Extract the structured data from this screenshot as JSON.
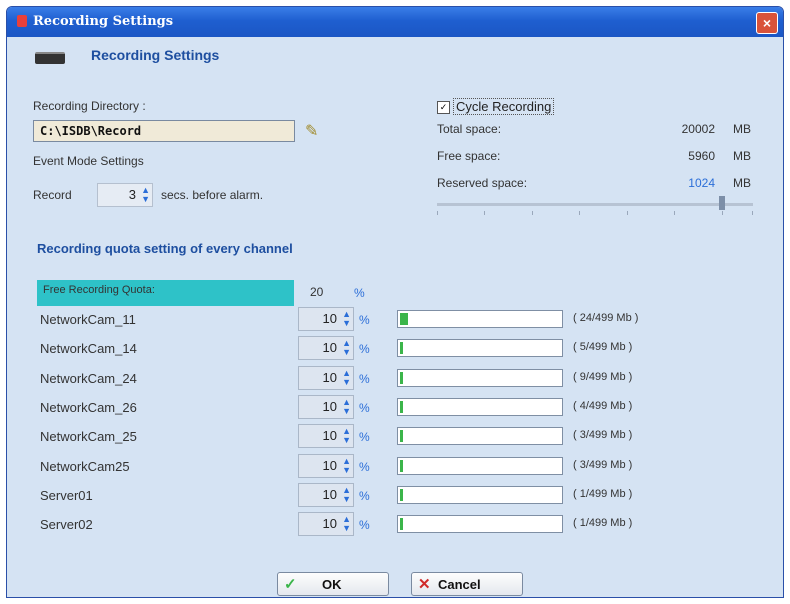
{
  "window": {
    "title": "Recording Settings",
    "close_icon": "×"
  },
  "header": {
    "title": "Recording  Settings",
    "icon": "recorder-icon"
  },
  "directory": {
    "label": "Recording Directory :",
    "value": "C:\\ISDB\\Record",
    "browse_icon": "browse-folder-icon"
  },
  "event_mode": {
    "label": "Event Mode Settings",
    "record_label": "Record",
    "seconds_value": "3",
    "suffix": "secs. before alarm."
  },
  "cycle": {
    "label": "Cycle Recording",
    "checked": true,
    "check_mark": "✓"
  },
  "space": {
    "total_label": "Total space:",
    "total_value": "20002",
    "free_label": "Free space:",
    "free_value": "5960",
    "reserved_label": "Reserved space:",
    "reserved_value": "1024",
    "unit": "MB",
    "reserved_slider_fraction": 0.91
  },
  "quota": {
    "section_title": "Recording quota setting of every channel",
    "free_label": "Free Recording Quota:",
    "free_value": "20",
    "percent": "%",
    "channels": [
      {
        "name": "NetworkCam_11",
        "value": "10",
        "usage": "( 24/499 Mb )",
        "fill": 0.05
      },
      {
        "name": "NetworkCam_14",
        "value": "10",
        "usage": "( 5/499 Mb )",
        "fill": 0.01
      },
      {
        "name": "NetworkCam_24",
        "value": "10",
        "usage": "( 9/499 Mb )",
        "fill": 0.02
      },
      {
        "name": "NetworkCam_26",
        "value": "10",
        "usage": "( 4/499 Mb )",
        "fill": 0.01
      },
      {
        "name": "NetworkCam_25",
        "value": "10",
        "usage": "( 3/499 Mb )",
        "fill": 0.01
      },
      {
        "name": "NetworkCam25",
        "value": "10",
        "usage": "( 3/499 Mb )",
        "fill": 0.01
      },
      {
        "name": "Server01",
        "value": "10",
        "usage": "( 1/499 Mb )",
        "fill": 0.01
      },
      {
        "name": "Server02",
        "value": "10",
        "usage": "( 1/499 Mb )",
        "fill": 0.01
      }
    ]
  },
  "buttons": {
    "ok_label": "OK",
    "ok_icon": "✓",
    "cancel_label": "Cancel",
    "cancel_icon": "✕"
  },
  "colors": {
    "accent": "#1e4fa0",
    "free_quota_bg": "#2ec2c8",
    "bar_fill": "#3bb54a"
  }
}
